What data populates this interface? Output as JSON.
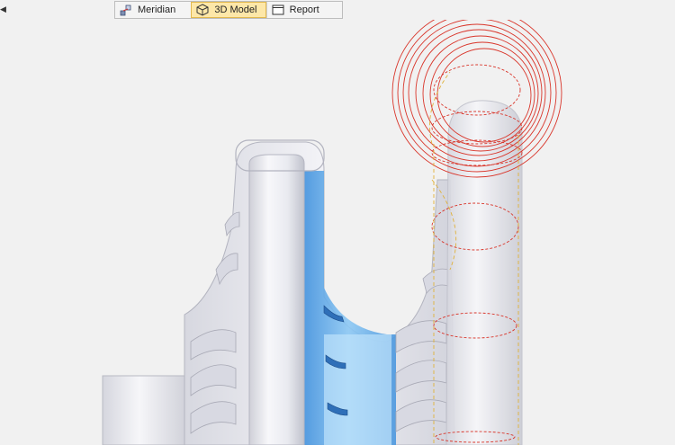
{
  "toolbar": {
    "collapse_icon": "triangle-left-icon",
    "tabs": [
      {
        "label": "Meridian",
        "icon": "meridian-icon",
        "active": false
      },
      {
        "label": "3D Model",
        "icon": "cube-icon",
        "active": true
      },
      {
        "label": "Report",
        "icon": "report-window-icon",
        "active": false
      }
    ]
  },
  "colors": {
    "background": "#f1f1f1",
    "active_tab": "#fde7a8",
    "casing": "#e8e8ee",
    "hub_blue": "#5ea8e6",
    "volute_wire": "#d9362b"
  }
}
